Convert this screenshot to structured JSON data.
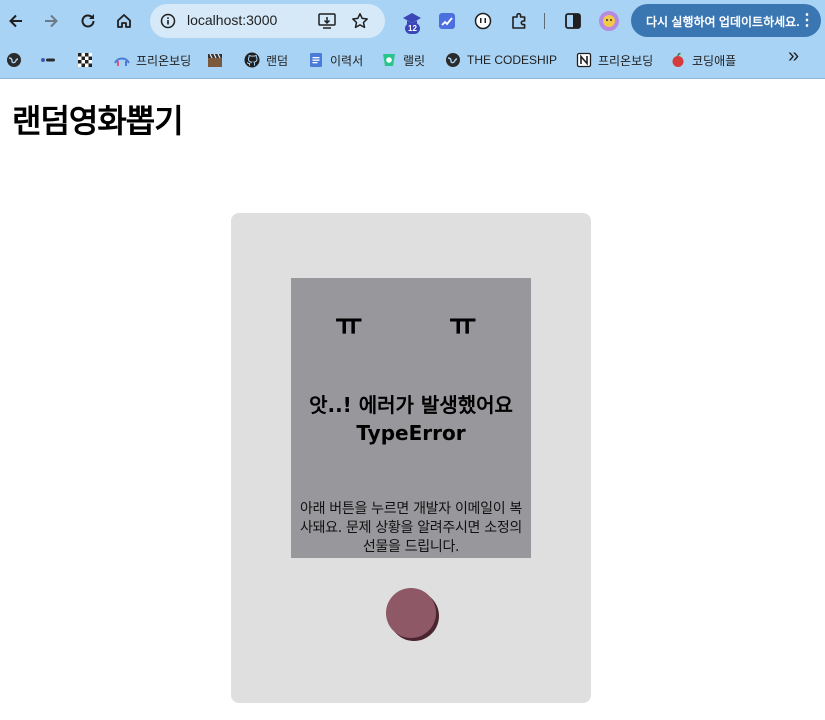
{
  "browser": {
    "url": "localhost:3000",
    "ext_badge": "12",
    "update_label": "다시 실행하여 업데이트하세요.",
    "menu_glyph": "⋮",
    "overflow_glyph": "»",
    "bookmarks": [
      {
        "label": "",
        "icon": "globe-icon"
      },
      {
        "label": "",
        "icon": "dash-icon"
      },
      {
        "label": "",
        "icon": "checker-icon"
      },
      {
        "label": "프리온보딩",
        "icon": "bridge-icon"
      },
      {
        "label": "",
        "icon": "clapper-icon"
      },
      {
        "label": "랜덤",
        "icon": "github-icon"
      },
      {
        "label": "이력서",
        "icon": "doc-icon"
      },
      {
        "label": "랠릿",
        "icon": "rallit-icon"
      },
      {
        "label": "THE CODESHIP",
        "icon": "globe-icon"
      },
      {
        "label": "프리온보딩",
        "icon": "notion-icon"
      },
      {
        "label": "코딩애플",
        "icon": "apple-icon"
      }
    ]
  },
  "page": {
    "title": "랜덤영화뽑기",
    "error": {
      "eye_left": "ㅠ",
      "eye_right": "ㅠ",
      "message": "앗..! 에러가 발생했어요",
      "type": "TypeError",
      "description": "아래 버튼을 누르면 개발자 이메일이 복사돼요. 문제 상황을 알려주시면 소정의 선물을 드립니다."
    }
  },
  "colors": {
    "chrome": "#a9d3f4",
    "card": "#dfdfdf",
    "error_box": "#98979b",
    "button": "#8e5866"
  }
}
